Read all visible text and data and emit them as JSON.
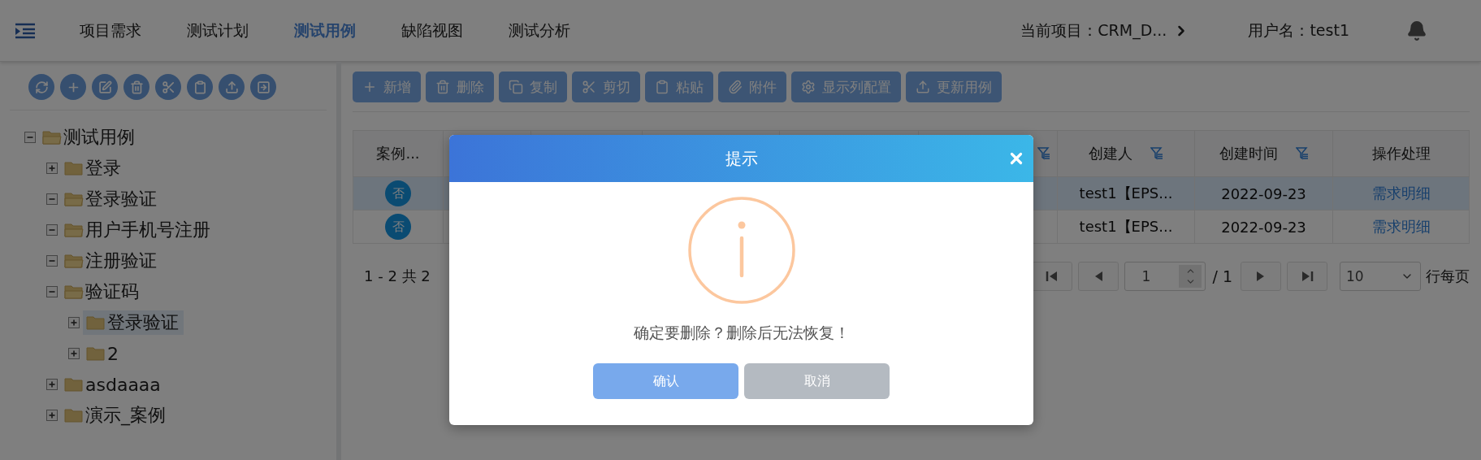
{
  "nav": {
    "items": [
      {
        "label": "项目需求",
        "selected": false
      },
      {
        "label": "测试计划",
        "selected": false
      },
      {
        "label": "测试用例",
        "selected": true
      },
      {
        "label": "缺陷视图",
        "selected": false
      },
      {
        "label": "测试分析",
        "selected": false
      }
    ],
    "project": "当前项目：CRM_D...",
    "user": "用户名：test1"
  },
  "toolbar": [
    "新增",
    "删除",
    "复制",
    "剪切",
    "粘贴",
    "附件",
    "显示列配置",
    "更新用例"
  ],
  "tree": {
    "label": "测试用例",
    "expanded": true,
    "selected": false,
    "children": [
      {
        "label": "登录",
        "expanded": false,
        "selected": false
      },
      {
        "label": "登录验证",
        "expanded": true,
        "selected": false
      },
      {
        "label": "用户手机号注册",
        "expanded": true,
        "selected": false
      },
      {
        "label": "注册验证",
        "expanded": true,
        "selected": false
      },
      {
        "label": "验证码",
        "expanded": true,
        "selected": false,
        "children": [
          {
            "label": "登录验证",
            "expanded": false,
            "selected": true
          },
          {
            "label": "2",
            "expanded": false,
            "selected": false
          }
        ]
      },
      {
        "label": "asdaaaa",
        "expanded": false,
        "selected": false
      },
      {
        "label": "演示_案例",
        "expanded": false,
        "selected": false
      }
    ]
  },
  "table": {
    "columns": [
      {
        "label": "案例...",
        "filter": false
      },
      {
        "filter": false
      },
      {
        "filter": false
      },
      {
        "filter": false
      },
      {
        "filter": false
      },
      {
        "filter": true
      },
      {
        "label": "创建人",
        "filter": true
      },
      {
        "label": "创建时间",
        "filter": true
      },
      {
        "label": "操作处理",
        "filter": false
      }
    ],
    "rows": [
      {
        "selected": true,
        "flag": "否",
        "creator": "test1【EPS...",
        "created": "2022-09-23",
        "action": "需求明细"
      },
      {
        "selected": false,
        "flag": "否",
        "creator": "test1【EPS...",
        "created": "2022-09-23",
        "action": "需求明细"
      }
    ]
  },
  "pagination": {
    "summary": "1 - 2 共 2",
    "page": "1",
    "total": "/ 1",
    "page_size": "10",
    "page_size_label": "行每页"
  },
  "dialog": {
    "title": "提示",
    "message": "确定要删除？删除后无法恢复！",
    "buttons": [
      {
        "label": "确认",
        "kind": "primary"
      },
      {
        "label": "取消",
        "kind": "secondary"
      }
    ]
  }
}
